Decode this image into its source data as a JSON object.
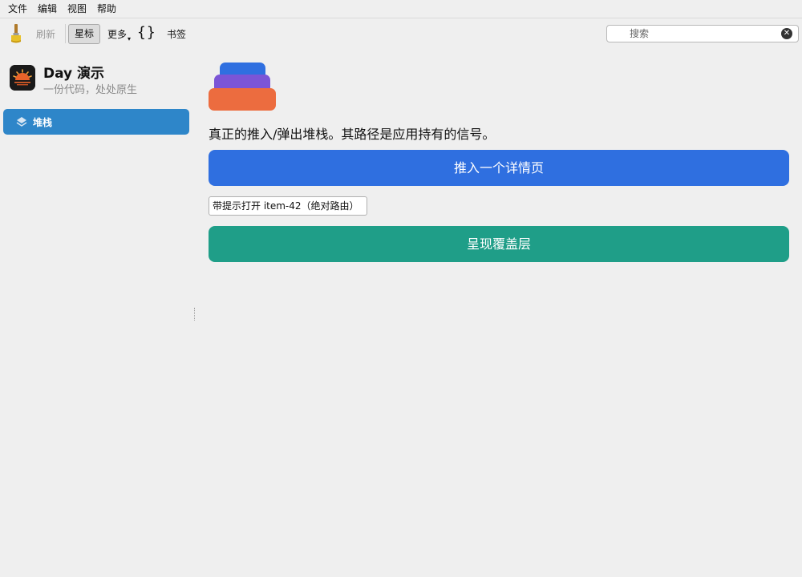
{
  "menubar": {
    "items": [
      "文件",
      "编辑",
      "视图",
      "帮助"
    ]
  },
  "toolbar": {
    "brush_icon": "paintbrush-icon",
    "refresh_label": "刷新",
    "star_label": "星标",
    "more_label": "更多",
    "braces_label": "{}",
    "bookmarks_label": "书签"
  },
  "search": {
    "placeholder": "搜索",
    "clear_icon": "clear-circle-icon"
  },
  "sidebar": {
    "app_title": "Day 演示",
    "app_subtitle": "一份代码，处处原生",
    "items": [
      {
        "label": "堆栈",
        "icon": "layers-icon",
        "selected": true
      }
    ]
  },
  "main": {
    "description": "真正的推入/弹出堆栈。其路径是应用持有的信号。",
    "push_button": "推入一个详情页",
    "open_hint_button": "带提示打开 item-42（绝对路由）",
    "overlay_button": "呈现覆盖层"
  },
  "colors": {
    "sidebar_selected": "#2e86c9",
    "push_button": "#2f6fe0",
    "overlay_button": "#1f9e88",
    "stack_top": "#2f6fe0",
    "stack_middle": "#7b55d6",
    "stack_bottom": "#ec6c3f"
  }
}
